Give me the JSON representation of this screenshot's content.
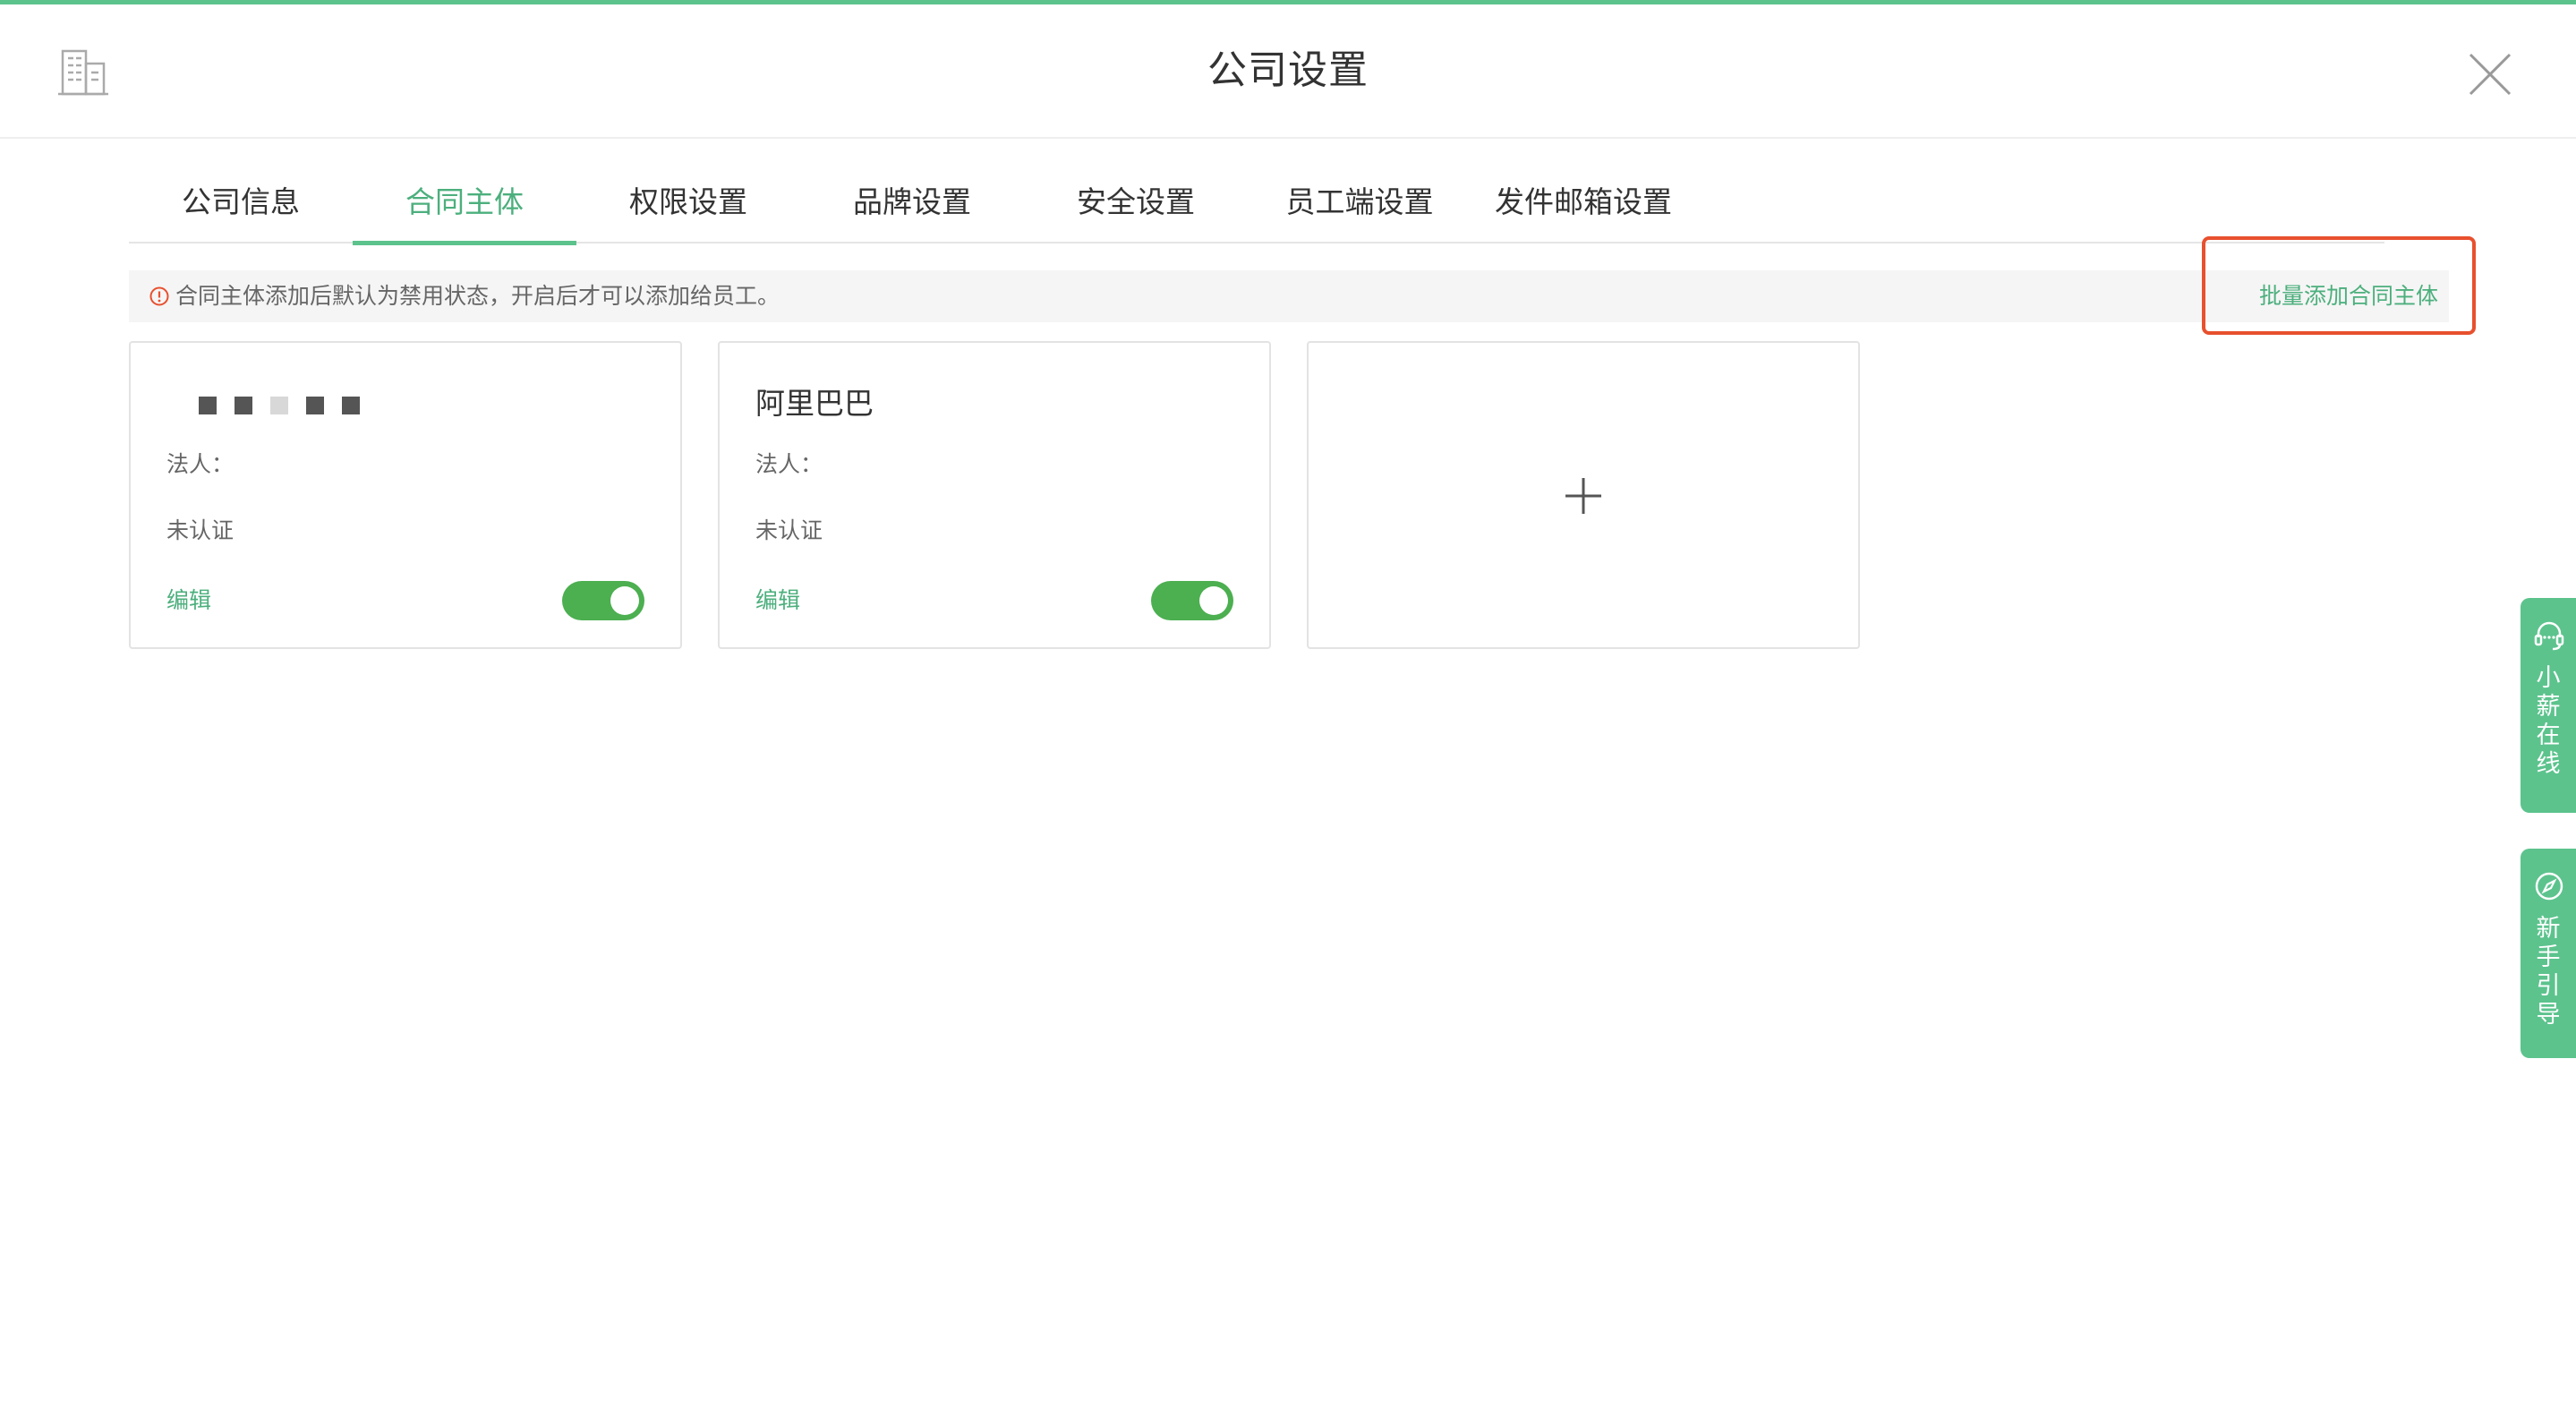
{
  "header": {
    "title": "公司设置",
    "icon": "building-icon",
    "close_icon": "close-icon"
  },
  "tabs": [
    {
      "label": "公司信息",
      "active": false
    },
    {
      "label": "合同主体",
      "active": true
    },
    {
      "label": "权限设置",
      "active": false
    },
    {
      "label": "品牌设置",
      "active": false
    },
    {
      "label": "安全设置",
      "active": false
    },
    {
      "label": "员工端设置",
      "active": false
    },
    {
      "label": "发件邮箱设置",
      "active": false
    }
  ],
  "notice": {
    "icon": "info-circle-icon",
    "text": "合同主体添加后默认为禁用状态，开启后才可以添加给员工。",
    "batch_add_label": "批量添加合同主体"
  },
  "cards": [
    {
      "title_masked": true,
      "legal_label": "法人：",
      "status": "未认证",
      "edit_label": "编辑",
      "enabled": true
    },
    {
      "title": "阿里巴巴",
      "legal_label": "法人：",
      "status": "未认证",
      "edit_label": "编辑",
      "enabled": true
    }
  ],
  "add_card": {
    "icon": "plus-icon"
  },
  "float_buttons": {
    "online": {
      "label": "小薪在线",
      "icon": "headset-icon"
    },
    "guide": {
      "label": "新手引导",
      "icon": "compass-icon"
    }
  },
  "colors": {
    "accent": "#5cc38d",
    "accent_text": "#4caf7d",
    "toggle_on": "#4caf50",
    "highlight": "#e8502e",
    "notice_icon": "#e8502e"
  }
}
